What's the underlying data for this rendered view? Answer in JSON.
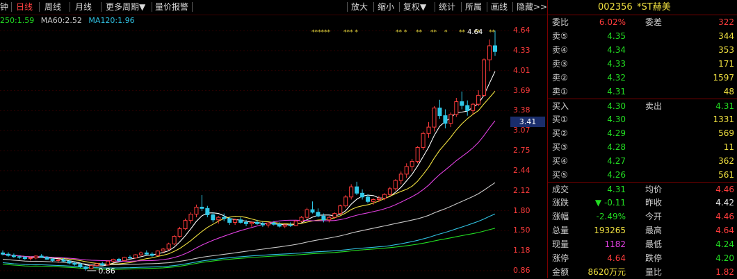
{
  "toolbar": {
    "period_fragment": "钟",
    "daily": "日线",
    "weekly": "周线",
    "monthly": "月线",
    "more_periods": "更多周期▼",
    "price_alert": "量价报警",
    "zoom_in": "放大",
    "zoom_out": "缩小",
    "adjust": "复权▼",
    "stats": "统计",
    "belong": "所属",
    "draw": "画线",
    "hide": "隐藏>>"
  },
  "ma_legend": {
    "ma250": "250:1.59",
    "ma60": "MA60:2.52",
    "ma120": "MA120:1.96"
  },
  "colors": {
    "up": "#ff3c3c",
    "down": "#22dd22",
    "ma5": "#ffffff",
    "ma10": "#f0e040",
    "ma20": "#e040e0",
    "ma60": "#c8c8c8",
    "ma120": "#30c0e0",
    "ma250": "#22dd22",
    "selection": "#1a2d6b"
  },
  "y_axis": {
    "ticks": [
      "4.64",
      "4.33",
      "4.01",
      "3.69",
      "3.38",
      "3.07",
      "2.75",
      "2.44",
      "2.12",
      "1.80",
      "1.50",
      "1.18",
      "0.86"
    ],
    "current": "3.41"
  },
  "annotations": {
    "high_label": "4.64",
    "low_label": "0.86",
    "star_marks": [
      "******",
      "*** *",
      "** *",
      "**",
      "**",
      "*",
      "**",
      "**",
      "**"
    ]
  },
  "chart_data": {
    "type": "candlestick",
    "ylim": [
      0.86,
      4.64
    ],
    "candles": [
      [
        1.14,
        1.18,
        1.1,
        1.12
      ],
      [
        1.12,
        1.15,
        1.08,
        1.1
      ],
      [
        1.1,
        1.13,
        1.06,
        1.08
      ],
      [
        1.08,
        1.1,
        1.04,
        1.07
      ],
      [
        1.07,
        1.09,
        1.03,
        1.05
      ],
      [
        1.05,
        1.08,
        1.02,
        1.06
      ],
      [
        1.06,
        1.1,
        1.04,
        1.09
      ],
      [
        1.09,
        1.12,
        1.06,
        1.07
      ],
      [
        1.07,
        1.09,
        1.03,
        1.04
      ],
      [
        1.04,
        1.06,
        1.0,
        1.02
      ],
      [
        1.02,
        1.05,
        0.98,
        1.03
      ],
      [
        1.03,
        1.06,
        1.0,
        1.01
      ],
      [
        1.01,
        1.03,
        0.96,
        0.98
      ],
      [
        0.98,
        1.0,
        0.94,
        0.96
      ],
      [
        0.96,
        0.98,
        0.9,
        0.92
      ],
      [
        0.92,
        0.94,
        0.86,
        0.89
      ],
      [
        0.89,
        0.95,
        0.88,
        0.94
      ],
      [
        0.94,
        0.98,
        0.92,
        0.97
      ],
      [
        0.97,
        1.0,
        0.94,
        0.95
      ],
      [
        0.95,
        1.02,
        0.94,
        1.01
      ],
      [
        1.01,
        1.05,
        0.99,
        1.04
      ],
      [
        1.04,
        1.06,
        1.0,
        1.02
      ],
      [
        1.02,
        1.08,
        1.01,
        1.07
      ],
      [
        1.07,
        1.1,
        1.04,
        1.06
      ],
      [
        1.06,
        1.12,
        1.05,
        1.11
      ],
      [
        1.11,
        1.16,
        1.09,
        1.14
      ],
      [
        1.14,
        1.18,
        1.1,
        1.12
      ],
      [
        1.12,
        1.15,
        1.08,
        1.1
      ],
      [
        1.1,
        1.18,
        1.09,
        1.17
      ],
      [
        1.17,
        1.22,
        1.14,
        1.2
      ],
      [
        1.2,
        1.3,
        1.18,
        1.28
      ],
      [
        1.28,
        1.42,
        1.26,
        1.4
      ],
      [
        1.4,
        1.55,
        1.38,
        1.52
      ],
      [
        1.52,
        1.68,
        1.5,
        1.65
      ],
      [
        1.65,
        1.78,
        1.6,
        1.75
      ],
      [
        1.75,
        1.9,
        1.7,
        1.86
      ],
      [
        1.86,
        2.05,
        1.8,
        1.84
      ],
      [
        1.84,
        1.88,
        1.7,
        1.74
      ],
      [
        1.74,
        1.78,
        1.62,
        1.66
      ],
      [
        1.66,
        1.72,
        1.6,
        1.7
      ],
      [
        1.7,
        1.76,
        1.64,
        1.68
      ],
      [
        1.68,
        1.7,
        1.58,
        1.62
      ],
      [
        1.62,
        1.68,
        1.58,
        1.66
      ],
      [
        1.66,
        1.7,
        1.6,
        1.62
      ],
      [
        1.62,
        1.66,
        1.56,
        1.6
      ],
      [
        1.6,
        1.64,
        1.55,
        1.62
      ],
      [
        1.62,
        1.66,
        1.58,
        1.6
      ],
      [
        1.6,
        1.63,
        1.55,
        1.58
      ],
      [
        1.58,
        1.62,
        1.54,
        1.61
      ],
      [
        1.61,
        1.64,
        1.57,
        1.59
      ],
      [
        1.59,
        1.62,
        1.54,
        1.56
      ],
      [
        1.56,
        1.6,
        1.53,
        1.58
      ],
      [
        1.58,
        1.62,
        1.55,
        1.57
      ],
      [
        1.57,
        1.66,
        1.56,
        1.64
      ],
      [
        1.64,
        1.72,
        1.62,
        1.7
      ],
      [
        1.7,
        1.85,
        1.68,
        1.82
      ],
      [
        1.82,
        1.95,
        1.76,
        1.78
      ],
      [
        1.78,
        1.84,
        1.7,
        1.72
      ],
      [
        1.72,
        1.76,
        1.62,
        1.66
      ],
      [
        1.66,
        1.72,
        1.62,
        1.7
      ],
      [
        1.7,
        1.78,
        1.68,
        1.76
      ],
      [
        1.76,
        1.9,
        1.74,
        1.88
      ],
      [
        1.88,
        2.05,
        1.85,
        2.02
      ],
      [
        2.02,
        2.22,
        1.98,
        2.18
      ],
      [
        2.18,
        2.26,
        2.05,
        2.08
      ],
      [
        2.08,
        2.14,
        1.98,
        2.02
      ],
      [
        2.02,
        2.06,
        1.92,
        1.95
      ],
      [
        1.95,
        2.0,
        1.9,
        1.98
      ],
      [
        1.98,
        2.04,
        1.94,
        2.0
      ],
      [
        2.0,
        2.08,
        1.97,
        2.06
      ],
      [
        2.06,
        2.18,
        2.04,
        2.15
      ],
      [
        2.15,
        2.3,
        2.12,
        2.28
      ],
      [
        2.28,
        2.42,
        2.22,
        2.38
      ],
      [
        2.38,
        2.55,
        2.32,
        2.5
      ],
      [
        2.5,
        2.62,
        2.42,
        2.58
      ],
      [
        2.58,
        2.82,
        2.55,
        2.8
      ],
      [
        2.8,
        3.05,
        2.76,
        3.02
      ],
      [
        3.02,
        3.2,
        2.95,
        3.12
      ],
      [
        3.12,
        3.45,
        3.05,
        3.42
      ],
      [
        3.42,
        3.55,
        3.25,
        3.3
      ],
      [
        3.3,
        3.4,
        3.1,
        3.18
      ],
      [
        3.18,
        3.35,
        3.12,
        3.32
      ],
      [
        3.32,
        3.58,
        3.28,
        3.52
      ],
      [
        3.52,
        3.68,
        3.4,
        3.46
      ],
      [
        3.46,
        3.54,
        3.3,
        3.38
      ],
      [
        3.38,
        3.5,
        3.32,
        3.48
      ],
      [
        3.48,
        3.7,
        3.45,
        3.62
      ],
      [
        3.62,
        4.2,
        3.6,
        4.18
      ],
      [
        4.18,
        4.5,
        4.0,
        4.4
      ],
      [
        4.4,
        4.64,
        4.24,
        4.31
      ]
    ]
  },
  "stock": {
    "code": "002356",
    "name": "*ST赫美",
    "weibi_label": "委比",
    "weibi": "6.02%",
    "weicha_label": "委差",
    "weicha": "322",
    "asks": [
      {
        "label": "卖⑤",
        "price": "4.35",
        "vol": "344"
      },
      {
        "label": "卖④",
        "price": "4.34",
        "vol": "353"
      },
      {
        "label": "卖③",
        "price": "4.33",
        "vol": "171"
      },
      {
        "label": "卖②",
        "price": "4.32",
        "vol": "1597"
      },
      {
        "label": "卖①",
        "price": "4.31",
        "vol": "48"
      }
    ],
    "buyin_label": "买入",
    "buyin": "4.30",
    "sellout_label": "卖出",
    "sellout": "4.31",
    "bids": [
      {
        "label": "买①",
        "price": "4.30",
        "vol": "1331"
      },
      {
        "label": "买②",
        "price": "4.29",
        "vol": "569"
      },
      {
        "label": "买③",
        "price": "4.28",
        "vol": "11"
      },
      {
        "label": "买④",
        "price": "4.27",
        "vol": "362"
      },
      {
        "label": "买⑤",
        "price": "4.26",
        "vol": "561"
      }
    ],
    "stats": [
      {
        "l1": "成交",
        "v1": "4.31",
        "c1": "dn",
        "l2": "均价",
        "v2": "4.46",
        "c2": "up"
      },
      {
        "l1": "涨跌",
        "v1": "▼ -0.11",
        "c1": "dn",
        "l2": "昨收",
        "v2": "4.42",
        "c2": "wh"
      },
      {
        "l1": "涨幅",
        "v1": "-2.49%",
        "c1": "dn",
        "l2": "今开",
        "v2": "4.46",
        "c2": "up"
      },
      {
        "l1": "总量",
        "v1": "193265",
        "c1": "yl",
        "l2": "最高",
        "v2": "4.64",
        "c2": "up"
      },
      {
        "l1": "现量",
        "v1": "1182",
        "c1": "mg",
        "l2": "最低",
        "v2": "4.24",
        "c2": "dn"
      },
      {
        "l1": "涨停",
        "v1": "4.64",
        "c1": "up",
        "l2": "跌停",
        "v2": "4.20",
        "c2": "dn"
      },
      {
        "l1": "金额",
        "v1": "8620万元",
        "c1": "yl",
        "l2": "量比",
        "v2": "1.82",
        "c2": "up"
      }
    ]
  }
}
